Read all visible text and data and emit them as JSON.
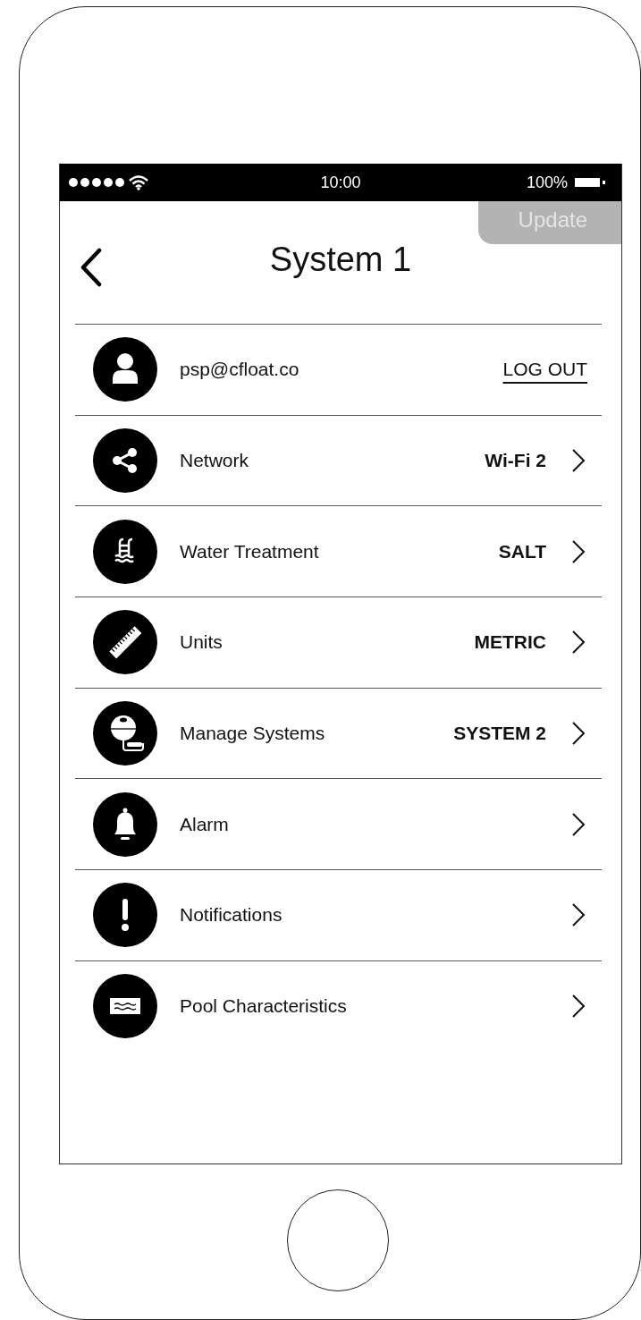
{
  "status_bar": {
    "time": "10:00",
    "battery": "100%"
  },
  "header": {
    "title": "System 1",
    "update_button": "Update"
  },
  "rows": [
    {
      "kind": "account",
      "label": "psp@cfloat.co",
      "action": "LOG OUT"
    },
    {
      "kind": "nav",
      "label": "Network",
      "value": "Wi-Fi 2"
    },
    {
      "kind": "nav",
      "label": "Water Treatment",
      "value": "SALT"
    },
    {
      "kind": "nav",
      "label": "Units",
      "value": "METRIC"
    },
    {
      "kind": "nav",
      "label": "Manage Systems",
      "value": "SYSTEM 2"
    },
    {
      "kind": "nav",
      "label": "Alarm"
    },
    {
      "kind": "nav",
      "label": "Notifications"
    },
    {
      "kind": "nav",
      "label": "Pool Characteristics"
    }
  ]
}
